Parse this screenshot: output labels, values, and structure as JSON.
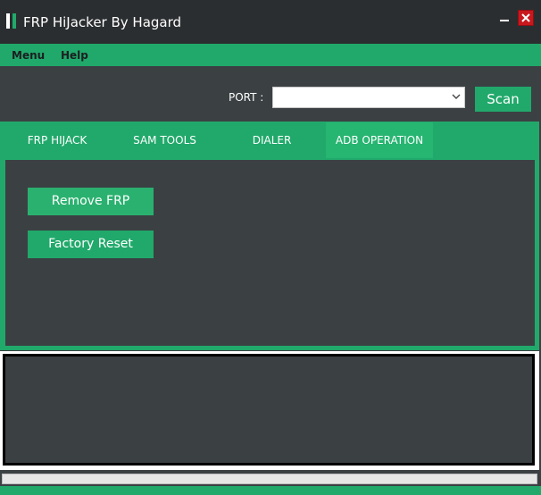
{
  "window": {
    "title": "FRP HiJacker By Hagard"
  },
  "menu": {
    "items": [
      "Menu",
      "Help"
    ]
  },
  "port": {
    "label": "PORT :",
    "selected": "",
    "scan_label": "Scan"
  },
  "tabs": {
    "items": [
      "FRP HIJACK",
      "SAM TOOLS",
      "DIALER",
      "ADB OPERATION"
    ],
    "active": "ADB OPERATION"
  },
  "adb": {
    "remove_frp": "Remove FRP",
    "factory_reset": "Factory Reset"
  },
  "progress": {
    "value": 0
  },
  "colors": {
    "accent": "#21a96b",
    "background": "#3b4043",
    "titlebar": "#2b2e30",
    "close": "#c8181e"
  }
}
